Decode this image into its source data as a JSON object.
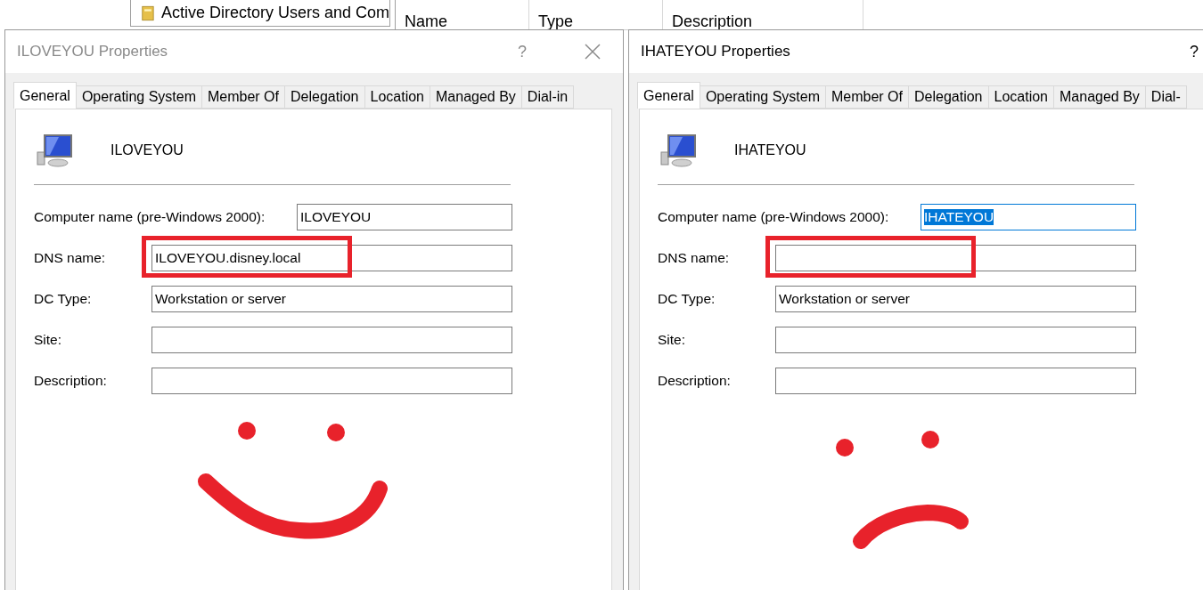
{
  "background_window": {
    "tree_item": "Active Directory Users and Com",
    "columns": [
      "Name",
      "Type",
      "Description"
    ]
  },
  "dialogs": [
    {
      "title": "ILOVEYOU Properties",
      "active": false,
      "help": "?",
      "close": true,
      "computer": "ILOVEYOU",
      "annotation": {
        "kind": "smile"
      },
      "tabs": [
        {
          "label": "General",
          "selected": true
        },
        {
          "label": "Operating System",
          "selected": false
        },
        {
          "label": "Member Of",
          "selected": false
        },
        {
          "label": "Delegation",
          "selected": false
        },
        {
          "label": "Location",
          "selected": false
        },
        {
          "label": "Managed By",
          "selected": false
        },
        {
          "label": "Dial-in",
          "selected": false
        }
      ],
      "fields": [
        {
          "label": "Computer name (pre-Windows 2000):",
          "value": "ILOVEYOU",
          "kind": "short",
          "focused": false,
          "highlighted": false
        },
        {
          "label": "DNS name:",
          "value": "ILOVEYOU.disney.local",
          "kind": "wide",
          "focused": false,
          "highlighted": true
        },
        {
          "label": "DC Type:",
          "value": "Workstation or server",
          "kind": "wide",
          "focused": false,
          "highlighted": false
        },
        {
          "label": "Site:",
          "kind": "wide",
          "focused": false,
          "highlighted": false
        },
        {
          "label": "Description:",
          "kind": "wide",
          "focused": false,
          "highlighted": false
        }
      ]
    },
    {
      "title": "IHATEYOU Properties",
      "active": true,
      "help": "?",
      "close": false,
      "computer": "IHATEYOU",
      "annotation": {
        "kind": "frown"
      },
      "tabs": [
        {
          "label": "General",
          "selected": true
        },
        {
          "label": "Operating System",
          "selected": false
        },
        {
          "label": "Member Of",
          "selected": false
        },
        {
          "label": "Delegation",
          "selected": false
        },
        {
          "label": "Location",
          "selected": false
        },
        {
          "label": "Managed By",
          "selected": false
        },
        {
          "label": "Dial-",
          "selected": false
        }
      ],
      "fields": [
        {
          "label": "Computer name (pre-Windows 2000):",
          "value": "IHATEYOU",
          "kind": "short",
          "focused": true,
          "highlighted": false
        },
        {
          "label": "DNS name:",
          "kind": "wide",
          "focused": false,
          "highlighted": true
        },
        {
          "label": "DC Type:",
          "value": "Workstation or server",
          "kind": "wide",
          "focused": false,
          "highlighted": false
        },
        {
          "label": "Site:",
          "kind": "wide",
          "focused": false,
          "highlighted": false
        },
        {
          "label": "Description:",
          "kind": "wide",
          "focused": false,
          "highlighted": false
        }
      ]
    }
  ]
}
